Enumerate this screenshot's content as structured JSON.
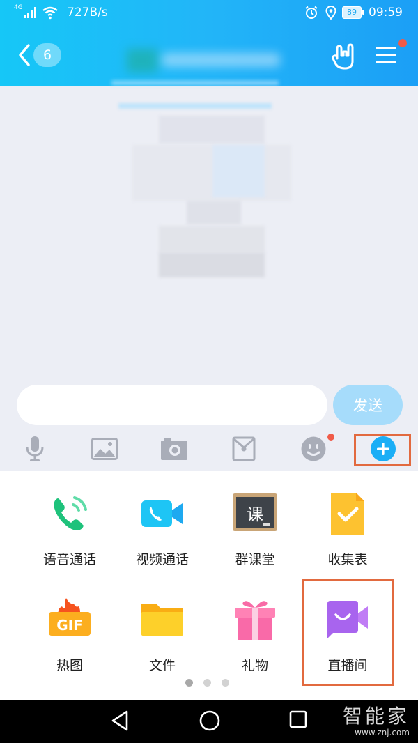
{
  "status_bar": {
    "network_type": "4G",
    "net_speed": "727B/s",
    "battery": "89",
    "time": "09:59"
  },
  "header": {
    "unread_count": "6"
  },
  "compose": {
    "input_value": "",
    "send_label": "发送"
  },
  "toolbar": {
    "icons": [
      "mic-icon",
      "image-icon",
      "camera-icon",
      "red-packet-icon",
      "emoji-icon",
      "plus-icon"
    ]
  },
  "panel": {
    "items": [
      {
        "label": "语音通话",
        "icon": "phone-call-icon"
      },
      {
        "label": "视频通话",
        "icon": "video-call-icon"
      },
      {
        "label": "群课堂",
        "icon": "blackboard-icon",
        "glyph": "课"
      },
      {
        "label": "收集表",
        "icon": "collect-form-icon"
      },
      {
        "label": "热图",
        "icon": "gif-icon",
        "glyph": "GIF"
      },
      {
        "label": "文件",
        "icon": "folder-icon"
      },
      {
        "label": "礼物",
        "icon": "gift-icon"
      },
      {
        "label": "直播间",
        "icon": "live-room-icon"
      }
    ],
    "pages": 3,
    "active_page": 0
  },
  "watermark": {
    "main": "智能家",
    "sub": "www.znj.com"
  },
  "colors": {
    "header_start": "#16c7f7",
    "header_end": "#1b9ff6",
    "send_button": "#a6dcfb",
    "highlight": "#e26a3f",
    "badge": "#f05b48"
  }
}
